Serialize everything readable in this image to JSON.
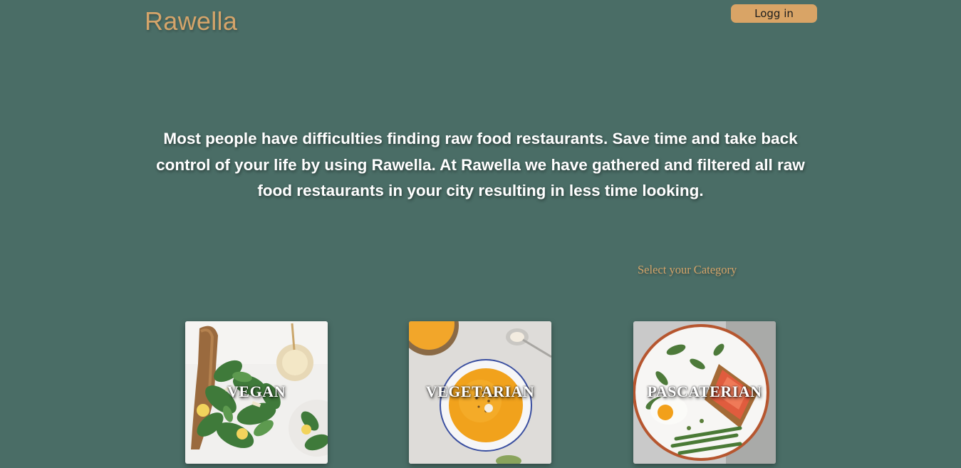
{
  "header": {
    "logo": "Rawella",
    "login_label": "Logg in"
  },
  "intro": {
    "text": "Most people have difficulties finding raw food restaurants. Save time and take back control of your life by using Rawella. At Rawella we have gathered and filtered all raw food restaurants in your city resulting in less time looking."
  },
  "categories": {
    "heading": "Select your Category",
    "items": [
      {
        "label": "VEGAN",
        "image": "salad-photo"
      },
      {
        "label": "VEGETARIAN",
        "image": "soup-photo"
      },
      {
        "label": "PASCATERIAN",
        "image": "fish-toast-photo"
      }
    ]
  },
  "colors": {
    "background": "#4a6d66",
    "accent": "#d4a46a",
    "button": "#d9a466",
    "text": "#ffffff"
  }
}
